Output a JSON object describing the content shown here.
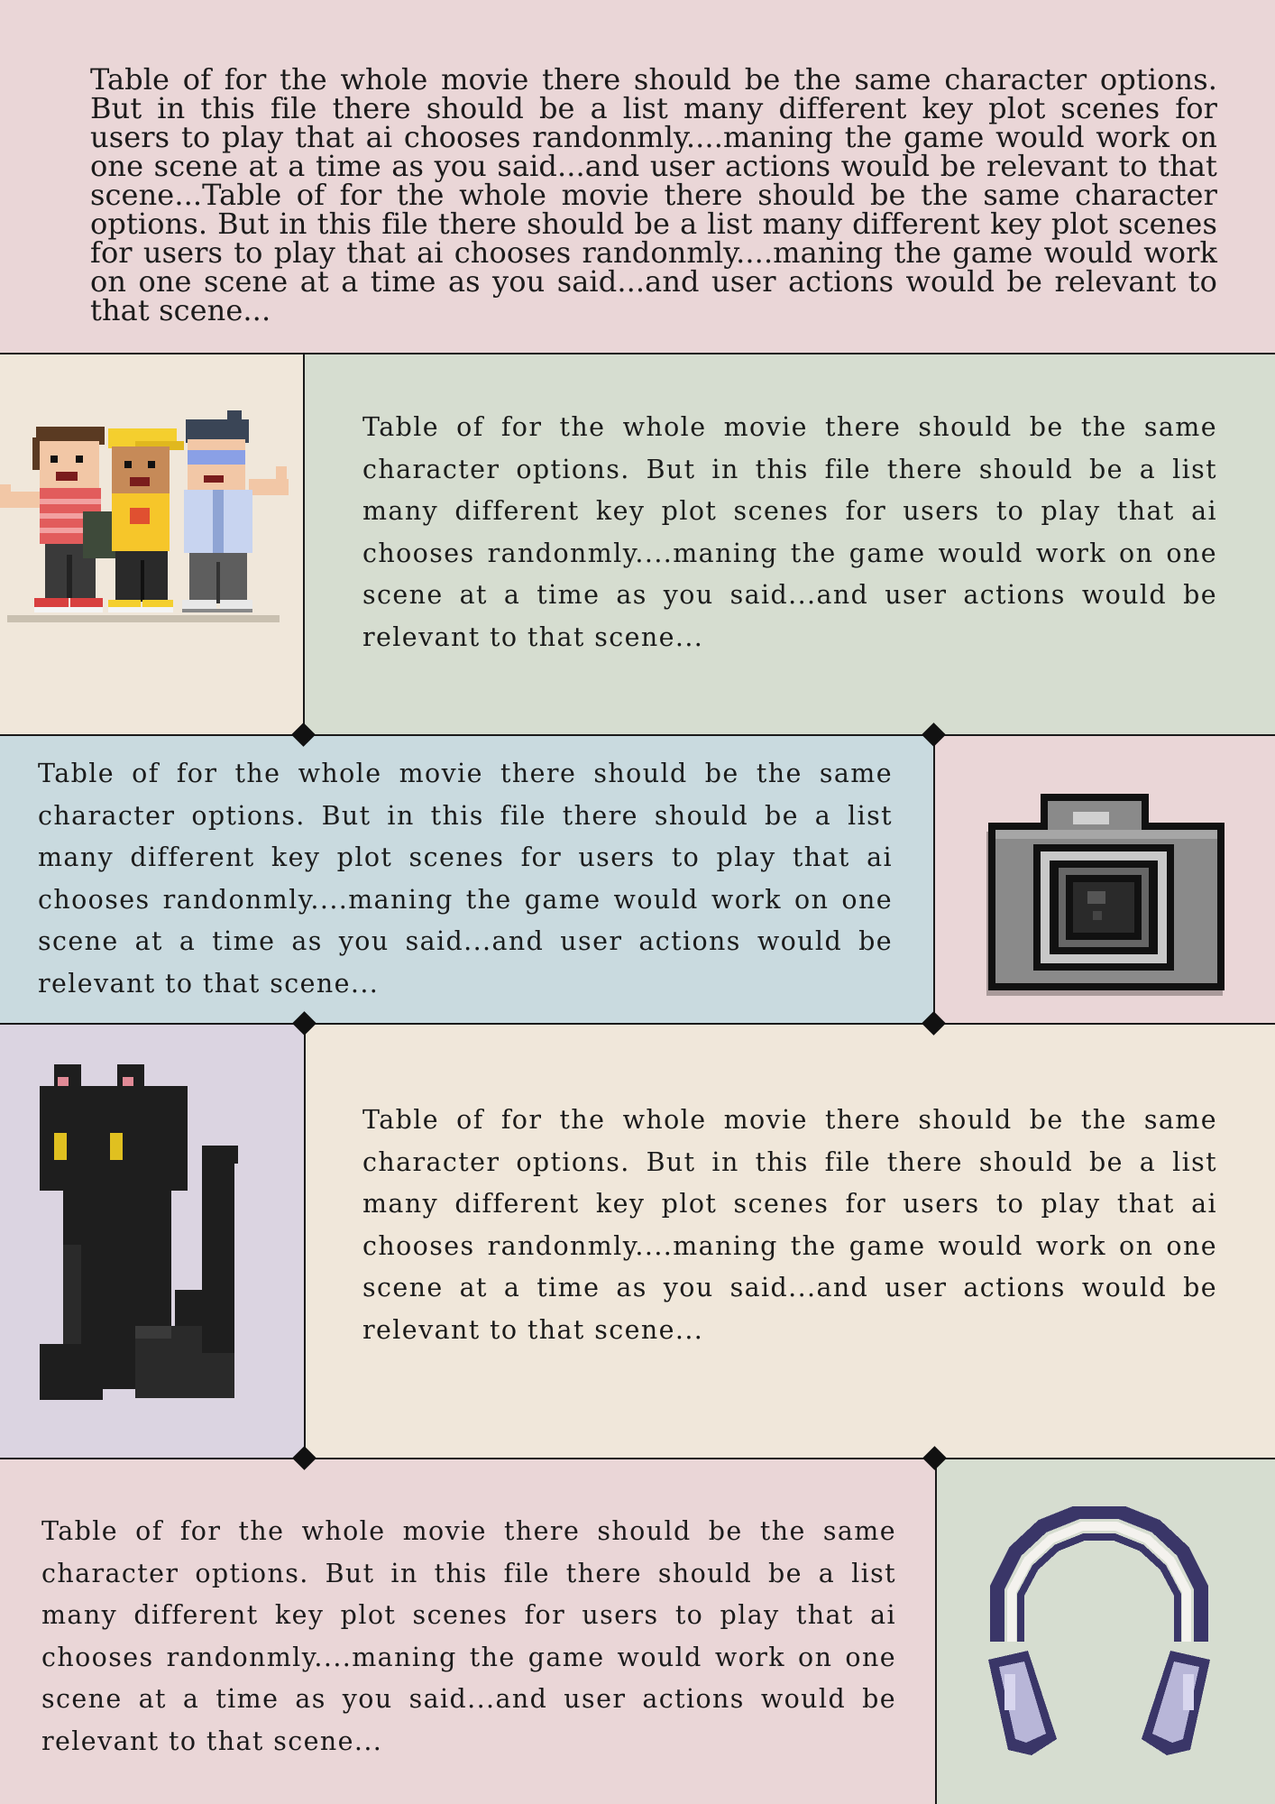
{
  "colors": {
    "pink": "#ead6d7",
    "cream": "#f0e7da",
    "sage": "#d6ddd0",
    "blue": "#c9dadf",
    "lavender": "#dbd4e1",
    "line": "#1a1a1a"
  },
  "intro": {
    "text": "Table of for the whole movie there should be the same character options. But in this file there should be a list many different key plot scenes for users to play that ai chooses randonmly....maning the game would work on one scene at a time as you said...and user actions would be relevant to that scene...Table of for the whole movie there should be the same character options. But in this file there should be a list many different key plot scenes for users to play that ai chooses randonmly....maning the game would work on one scene at a time as you said...and user actions would be relevant to that scene..."
  },
  "rows": [
    {
      "icon": "three-kids-pixel-icon",
      "text": "Table of for the whole movie there should be the same character options. But in this file there should be a list many different key plot scenes for users to play that ai chooses randonmly....maning the game would work on one scene at a time as you said...and user actions would be relevant to that scene..."
    },
    {
      "icon": "camera-pixel-icon",
      "text": "Table of for the whole movie there should be the same character options. But in this file there should be a list many different key plot scenes for users to play that ai chooses randonmly....maning the game would work on one scene at a time as you said...and user actions would be relevant to that scene..."
    },
    {
      "icon": "black-cat-pixel-icon",
      "text": "Table of for the whole movie there should be the same character options. But in this file there should be a list many different key plot scenes for users to play that ai chooses randonmly....maning the game would work on one scene at a time as you said...and user actions would be relevant to that scene..."
    },
    {
      "icon": "headphones-pixel-icon",
      "text": "Table of for the whole movie there should be the same character options. But in this file there should be a list many different key plot scenes for users to play that ai chooses randonmly....maning the game would work on one scene at a time as you said...and user actions would be relevant to that scene..."
    }
  ]
}
